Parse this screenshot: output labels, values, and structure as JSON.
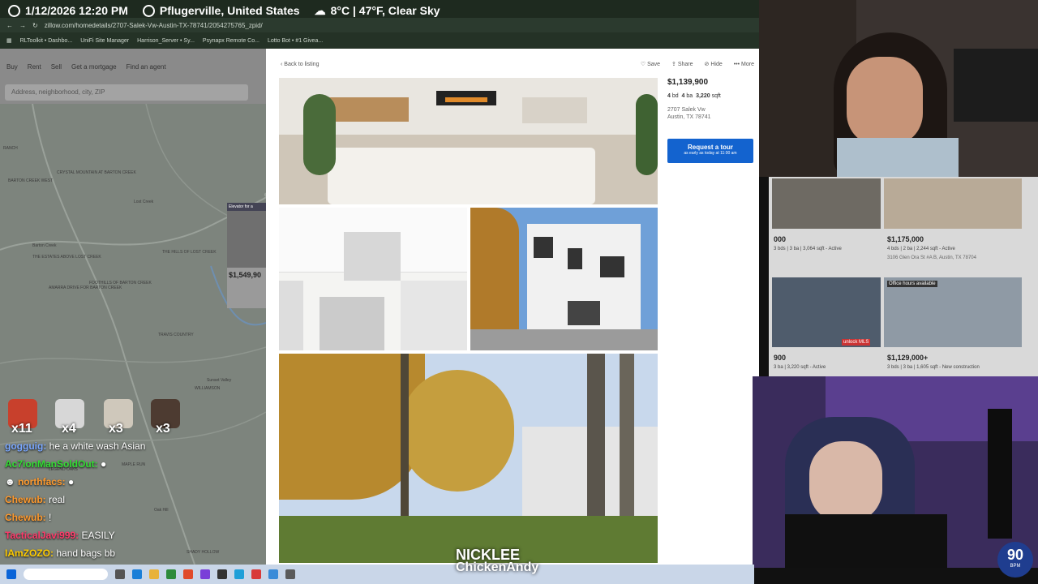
{
  "overlay": {
    "datetime": "1/12/2026 12:20 PM",
    "location": "Pflugerville, United States",
    "weather": "8°C | 47°F, Clear Sky"
  },
  "browser": {
    "url": "zillow.com/homedetails/2707-Salek-Vw-Austin-TX-78741/2054275765_zpid/",
    "bookmarks": [
      "RLToolkit • Dashbo...",
      "UniFi Site Manager",
      "Harrison_Server • Sy...",
      "Psynapx Remote Co...",
      "Lotto Bot • #1 Givea..."
    ]
  },
  "map": {
    "nav": [
      "Buy",
      "Rent",
      "Sell",
      "Get a mortgage",
      "Find an agent"
    ],
    "search_placeholder": "Address, neighborhood, city, ZIP",
    "labels": [
      "RANCH",
      "CRYSTAL MOUNTAIN AT BARTON CREEK",
      "BARTON CREEK WEST",
      "Lost Creek",
      "Barton Creek",
      "THE ESTATES ABOVE LOST CREEK",
      "THE HILLS OF LOST CREEK",
      "FOOTHILLS OF BARTON CREEK",
      "AMARRA DRIVE FOR BARTON CREEK",
      "TRAVIS COUNTRY",
      "Sunset Valley",
      "WILLIAMSON",
      "MAPLE RUN",
      "LEGEND OAKS",
      "Oak Hill",
      "SHADY HOLLOW"
    ],
    "chip_price": "$1,549,90",
    "chip_tag": "Elevator for a"
  },
  "listing": {
    "back_label": "Back to listing",
    "actions": [
      "Save",
      "Share",
      "Hide",
      "More"
    ],
    "price": "$1,139,900",
    "beds": "4",
    "beds_unit": "bd",
    "baths": "4",
    "baths_unit": "ba",
    "sqft": "3,220",
    "sqft_unit": "sqft",
    "address_line1": "2707 Salek Vw",
    "address_line2": "Austin, TX 78741",
    "tour_title": "Request a tour",
    "tour_sub": "as early as today at 11:00 am"
  },
  "cards": [
    {
      "price": "000",
      "meta": "3 bds | 3 ba | 3,064 sqft - Active"
    },
    {
      "price": "$1,175,000",
      "meta": "4 bds | 2 ba | 2,244 sqft - Active",
      "address": "3106 Glen Ora St #A B, Austin, TX 78704"
    },
    {
      "price": "900",
      "meta": "3 ba | 3,220 sqft - Active",
      "badge": "unlock MLS"
    },
    {
      "price": "$1,129,000+",
      "meta": "3 bds | 3 ba | 1,605 sqft - New construction",
      "badge": "Office hours available"
    }
  ],
  "chat": {
    "emote_counts": [
      "x11",
      "x4",
      "x3",
      "x3"
    ],
    "messages": [
      {
        "user": "gogguig:",
        "text": "he a white wash Asian",
        "color": "#7aa7ff"
      },
      {
        "user": "Ac7ionManSoldOut:",
        "text": "",
        "color": "#33dd33"
      },
      {
        "user": "northfacs:",
        "text": "",
        "color": "#ff9a2e"
      },
      {
        "user": "Chewub:",
        "text": "real",
        "color": "#ff9a2e"
      },
      {
        "user": "Chewub:",
        "text": "!",
        "color": "#ff9a2e"
      },
      {
        "user": "TacticalJavi999:",
        "text": "EASILY",
        "color": "#ff3b6b"
      },
      {
        "user": "IAmZOZO:",
        "text": "hand bags bb",
        "color": "#ffcc00"
      }
    ]
  },
  "stream": {
    "name1": "NICKLEE",
    "name2": "ChickenAndy",
    "bpm": "90",
    "bpm_label": "BPM"
  },
  "colors": {
    "accent": "#1363cf",
    "map": "#7d847d"
  }
}
